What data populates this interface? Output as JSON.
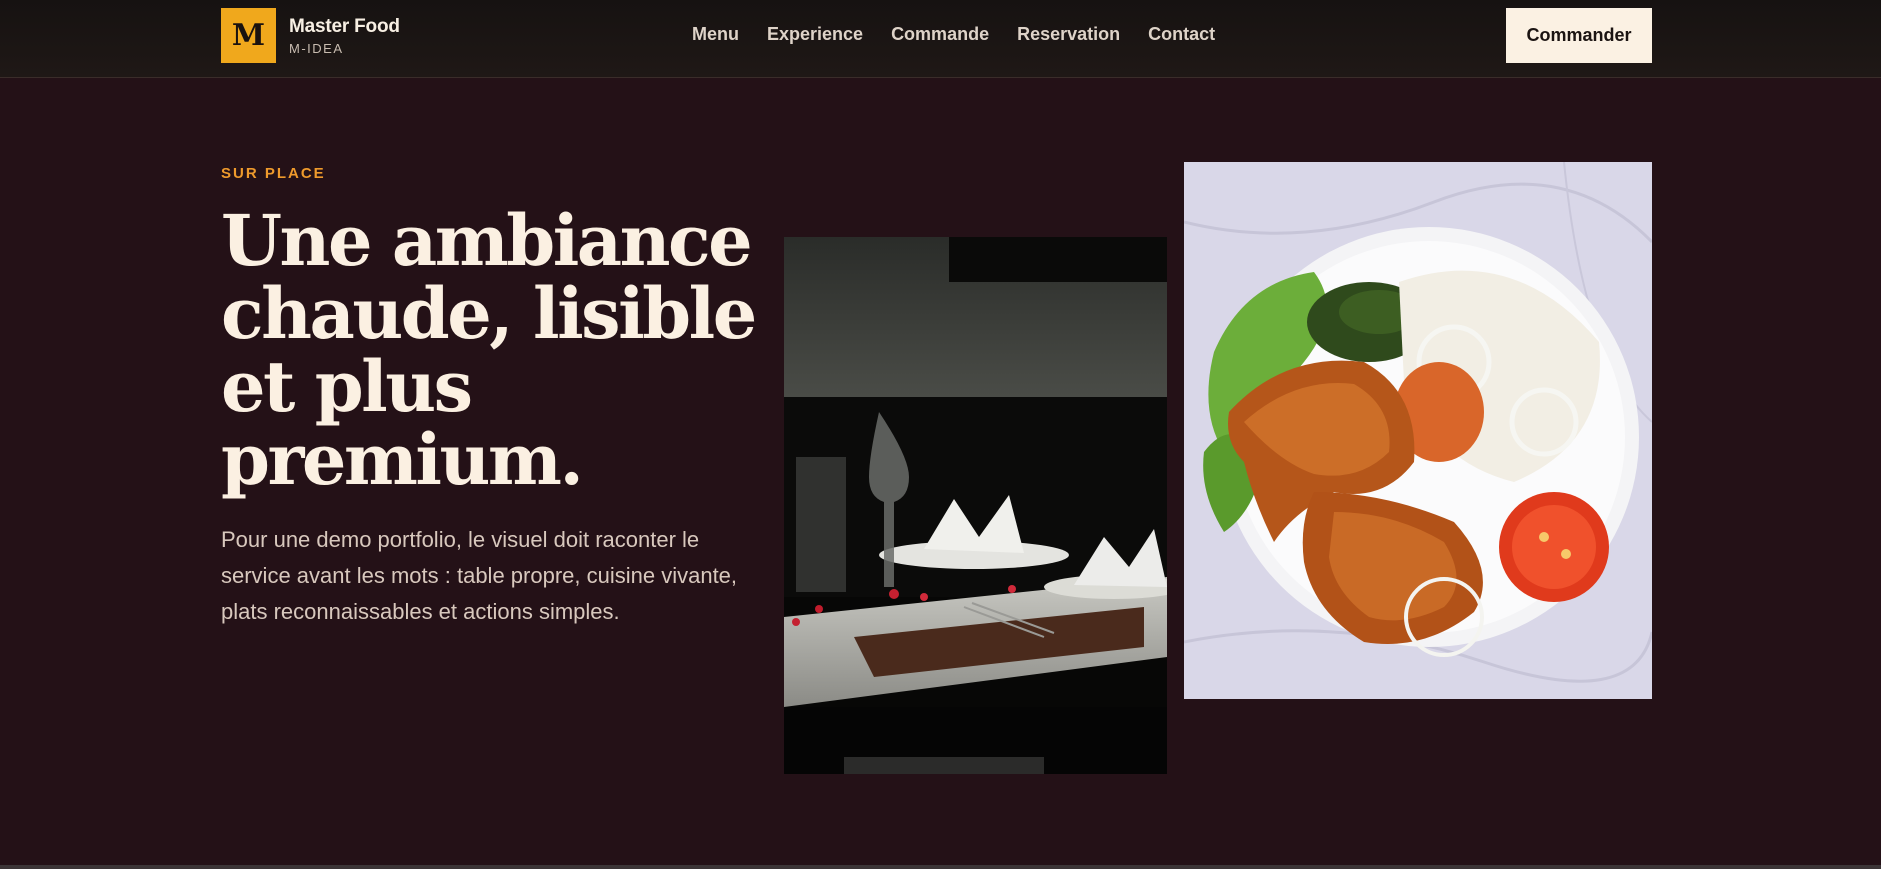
{
  "brand": {
    "logo_letter": "M",
    "name": "Master Food",
    "sub": "M-IDEA"
  },
  "nav": {
    "items": [
      "Menu",
      "Experience",
      "Commande",
      "Reservation",
      "Contact"
    ]
  },
  "header": {
    "cta_label": "Commander"
  },
  "hero": {
    "eyebrow": "SUR PLACE",
    "headline": "Une ambiance chaude, lisible et plus premium.",
    "lead": "Pour une demo portfolio, le visuel doit raconter le service avant les mots : table propre, cuisine vivante, plats reconnaissables et actions simples."
  },
  "colors": {
    "background": "#241117",
    "accent": "#f0a81c",
    "eyebrow": "#ee9a2c",
    "cta_bg": "#fbf1e3"
  }
}
